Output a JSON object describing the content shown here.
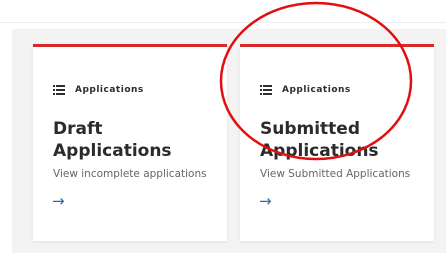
{
  "cards": [
    {
      "category": "Applications",
      "title": "Draft Applications",
      "description": "View incomplete applications",
      "arrow": "→"
    },
    {
      "category": "Applications",
      "title": "Submitted Applications",
      "description": "View Submitted Applications",
      "arrow": "→"
    }
  ],
  "colors": {
    "card_accent": "#d62b2b",
    "annotation_circle": "#e01010",
    "link": "#2b6cb0"
  },
  "icons": [
    "list-icon",
    "arrow-right-icon"
  ]
}
